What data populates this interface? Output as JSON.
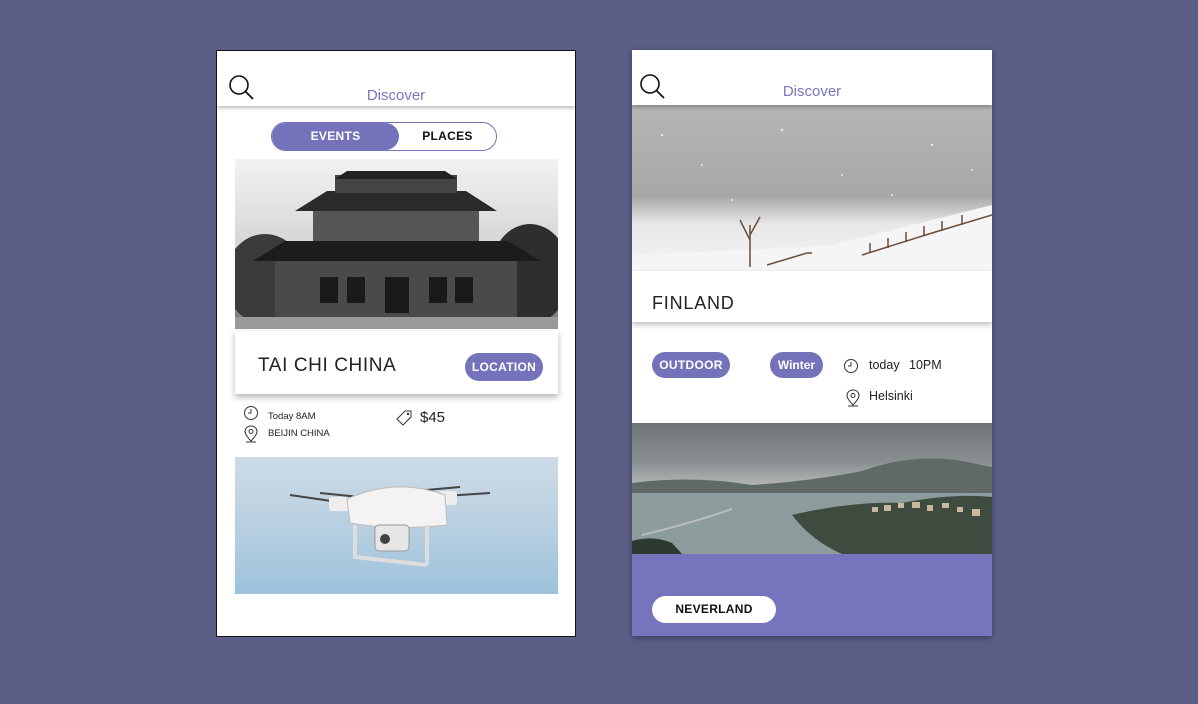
{
  "colors": {
    "background": "#5b5e87",
    "accent": "#7472bb",
    "title": "#7a77bd"
  },
  "screen_left": {
    "header": {
      "title": "Discover",
      "search_icon": "search-icon"
    },
    "tabs": [
      {
        "label": "EVENTS",
        "active": true
      },
      {
        "label": "PLACES",
        "active": false
      }
    ],
    "event": {
      "name": "TAI CHI CHINA",
      "location_button": "LOCATION",
      "time": "Today 8AM",
      "place": "BEIJIN CHINA",
      "price": "$45",
      "icons": [
        "clock-icon",
        "location-pin-icon",
        "price-tag-icon"
      ]
    }
  },
  "screen_right": {
    "header": {
      "title": "Discover",
      "search_icon": "search-icon"
    },
    "place": {
      "name": "FINLAND",
      "tags": [
        "OUTDOOR",
        "Winter"
      ],
      "time_day": "today",
      "time_hour": "10PM",
      "city": "Helsinki"
    },
    "footer": {
      "button": "NEVERLAND"
    }
  }
}
